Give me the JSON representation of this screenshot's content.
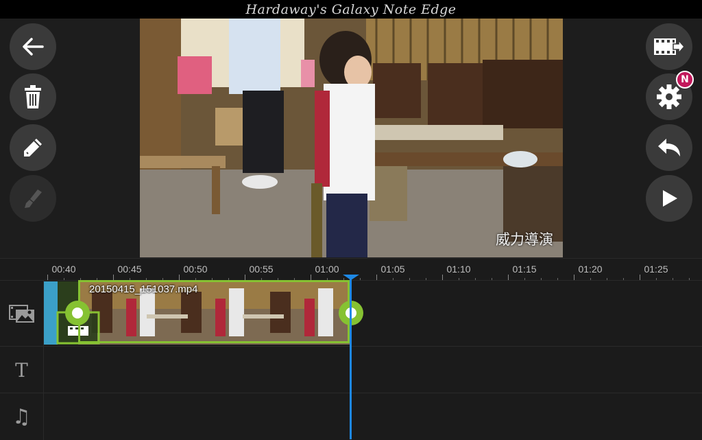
{
  "app": {
    "header_watermark": "Hardaway's Galaxy Note Edge"
  },
  "left_toolbar": [
    {
      "name": "back-button",
      "icon": "arrow-left-icon"
    },
    {
      "name": "delete-button",
      "icon": "trash-icon"
    },
    {
      "name": "edit-button",
      "icon": "pencil-icon"
    },
    {
      "name": "tools-button",
      "icon": "brush-icon",
      "disabled": true
    }
  ],
  "right_toolbar": [
    {
      "name": "export-button",
      "icon": "film-export-icon"
    },
    {
      "name": "settings-button",
      "icon": "gear-icon",
      "badge": "N"
    },
    {
      "name": "undo-button",
      "icon": "undo-icon"
    },
    {
      "name": "play-button",
      "icon": "play-icon"
    }
  ],
  "preview": {
    "watermark": "威力導演"
  },
  "timeline": {
    "ruler_labels": [
      "00:40",
      "00:45",
      "00:50",
      "00:55",
      "01:00",
      "01:05",
      "01:10",
      "01:15",
      "01:20",
      "01:25"
    ],
    "clip": {
      "filename": "20150415_151037.mp4"
    },
    "tracks": [
      {
        "name": "video-track",
        "icon": "video-track-icon"
      },
      {
        "name": "text-track",
        "icon": "text-track-icon",
        "glyph": "T"
      },
      {
        "name": "audio-track",
        "icon": "music-note-icon",
        "glyph": "♫"
      }
    ]
  },
  "colors": {
    "accent": "#86c232",
    "playhead": "#1e88e5",
    "badge": "#c2185b"
  }
}
